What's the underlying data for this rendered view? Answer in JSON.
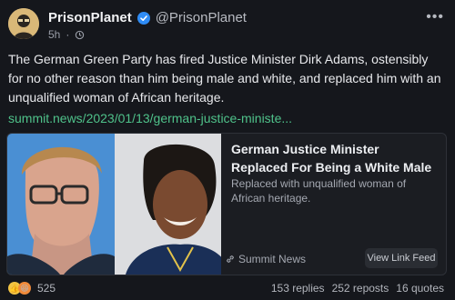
{
  "author": {
    "display_name": "PrisonPlanet",
    "handle": "@PrisonPlanet",
    "time": "5h"
  },
  "post": {
    "text": "The German Green Party has fired Justice Minister Dirk Adams, ostensibly for no other reason than him being male and white, and replaced him with an unqualified woman of African heritage.",
    "link": "summit.news/2023/01/13/german-justice-ministe..."
  },
  "card": {
    "title": "German Justice Minister Replaced For Being a White Male",
    "description": "Replaced with unqualified woman of African heritage.",
    "source": "Summit News",
    "button_label": "View Link Feed"
  },
  "footer": {
    "reactions_count": "525",
    "replies": "153 replies",
    "reposts": "252 reposts",
    "quotes": "16 quotes"
  },
  "colors": {
    "background": "#15171c",
    "link": "#4fc28a",
    "verified": "#2f8cf5"
  }
}
